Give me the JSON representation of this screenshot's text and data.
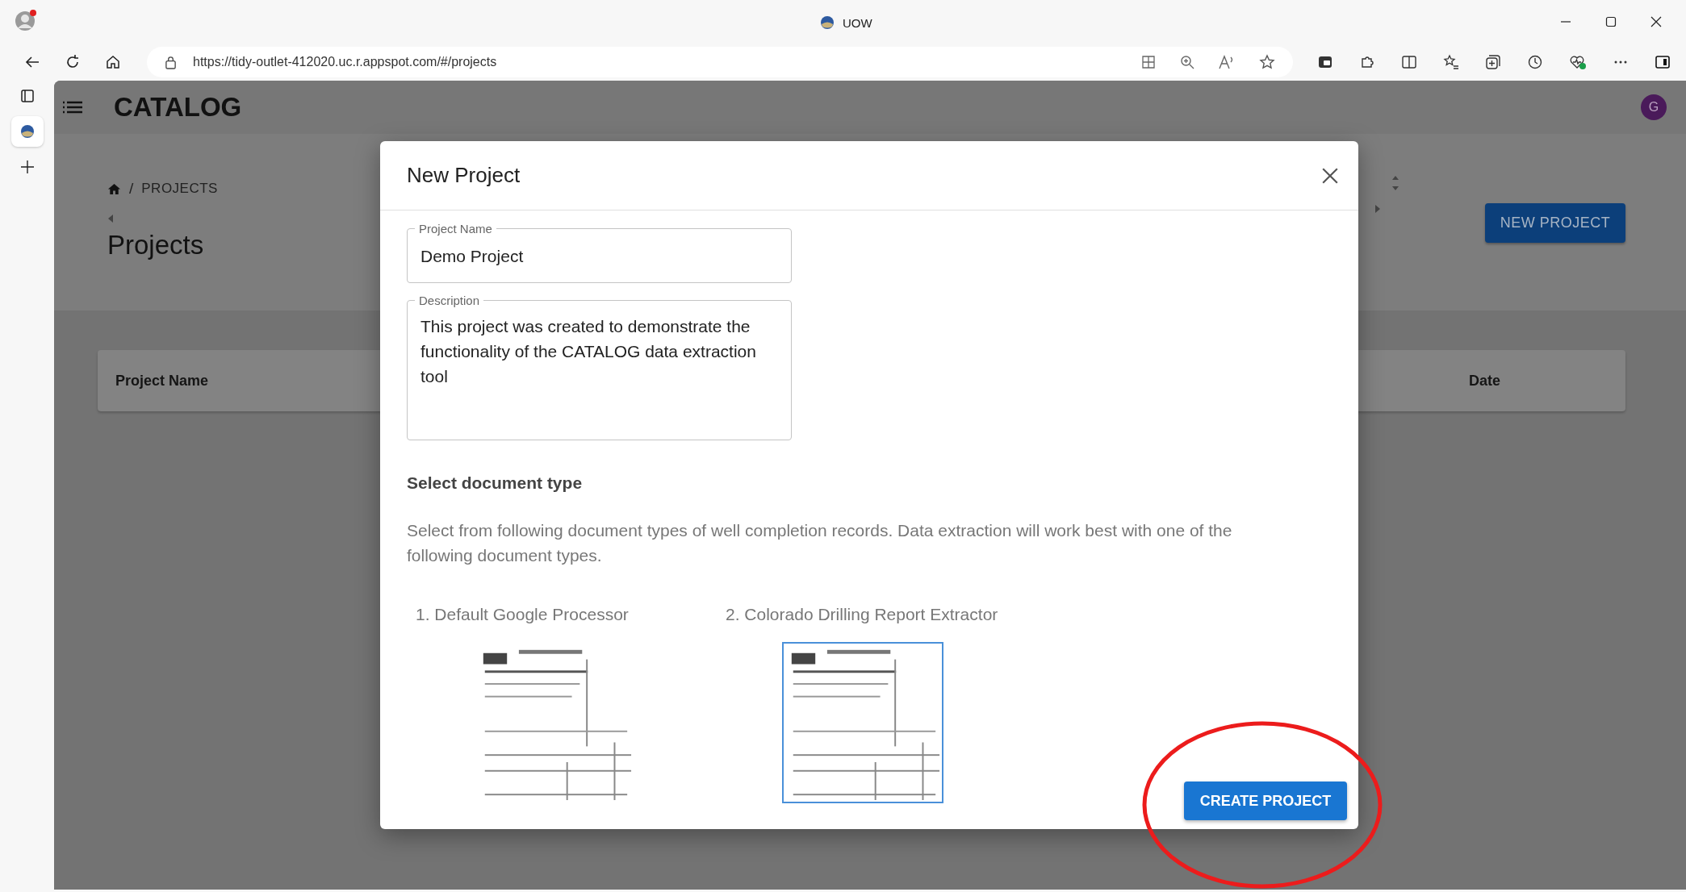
{
  "browser": {
    "tab_title": "UOW",
    "url": "https://tidy-outlet-412020.uc.r.appspot.com/#/projects"
  },
  "app": {
    "title": "CATALOG",
    "avatar": "G"
  },
  "breadcrumb": {
    "separator": "/",
    "items": [
      "PROJECTS"
    ]
  },
  "page_title": "Projects",
  "new_project_button": "NEW PROJECT",
  "table": {
    "columns": [
      "Project Name",
      "Date"
    ]
  },
  "dialog": {
    "title": "New Project",
    "fields": [
      {
        "kind": "input",
        "label": "Project Name",
        "value": "Demo Project"
      },
      {
        "kind": "textarea",
        "label": "Description",
        "value": "This project was created to demonstrate the functionality of the CATALOG data extraction tool"
      }
    ],
    "section_title": "Select document type",
    "section_text": "Select from following document types of well completion records. Data extraction will work best with one of the following document types.",
    "document_types": [
      {
        "label": "1. Default Google Processor",
        "selected": false
      },
      {
        "label": "2. Colorado Drilling Report Extractor",
        "selected": true
      }
    ],
    "submit_button": "CREATE PROJECT"
  }
}
